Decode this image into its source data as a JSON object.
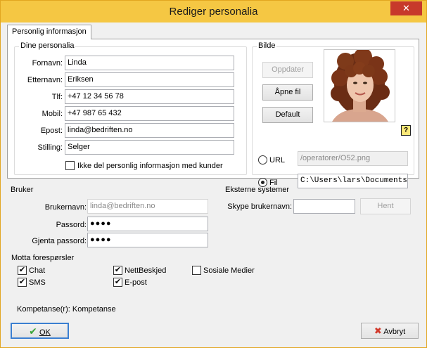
{
  "window": {
    "title": "Rediger personalia",
    "close_glyph": "✕"
  },
  "tabs": [
    {
      "label": "Personlig informasjon"
    }
  ],
  "personalia": {
    "group_label": "Dine personalia",
    "fields": [
      {
        "label": "Fornavn:",
        "value": "Linda"
      },
      {
        "label": "Etternavn:",
        "value": "Eriksen"
      },
      {
        "label": "Tlf:",
        "value": "+47 12 34 56 78"
      },
      {
        "label": "Mobil:",
        "value": "+47 987 65 432"
      },
      {
        "label": "Epost:",
        "value": "linda@bedriften.no"
      },
      {
        "label": "Stilling:",
        "value": "Selger"
      }
    ],
    "hide_checkbox_label": "Ikke del personlig informasjon med kunder",
    "hide_checked": false
  },
  "bilde": {
    "group_label": "Bilde",
    "update_button": "Oppdater",
    "open_button": "Åpne fil",
    "default_button": "Default",
    "url_label": "URL",
    "url_value": "/operatorer/O52.png",
    "file_label": "Fil",
    "file_value": "C:\\Users\\lars\\Documents\\Guider",
    "selected_source": "Fil",
    "help_icon": "?"
  },
  "bruker": {
    "group_label": "Bruker",
    "username_label": "Brukernavn:",
    "username_value": "linda@bedriften.no",
    "password_label": "Passord:",
    "password_value": "●●●●",
    "repeat_label": "Gjenta passord:",
    "repeat_value": "●●●●"
  },
  "eksterne": {
    "group_label": "Eksterne systemer",
    "skype_label": "Skype brukernavn:",
    "skype_value": "",
    "fetch_button": "Hent"
  },
  "requests": {
    "label": "Motta forespørsler",
    "check_glyph": "✔",
    "options": [
      {
        "label": "Chat",
        "checked": true
      },
      {
        "label": "NettBeskjed",
        "checked": true
      },
      {
        "label": "Sosiale Medier",
        "checked": false
      },
      {
        "label": "SMS",
        "checked": true
      },
      {
        "label": "E-post",
        "checked": true
      }
    ]
  },
  "competence": {
    "text": "Kompetanse(r): Kompetanse"
  },
  "footer": {
    "ok_label": "OK",
    "ok_icon": "✔",
    "cancel_label": "Avbryt",
    "cancel_icon": "✖"
  },
  "colors": {
    "titlebar": "#f5c743",
    "close": "#c7392b",
    "ok_green": "#3aa53a",
    "cancel_red": "#d23a2c"
  }
}
